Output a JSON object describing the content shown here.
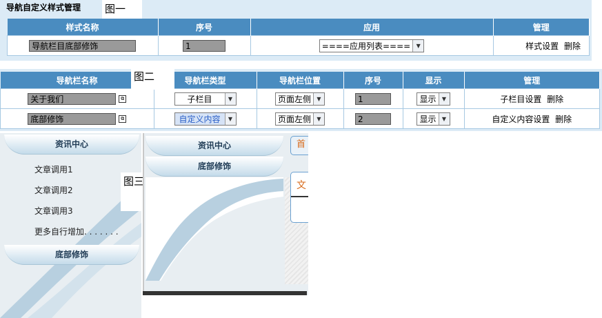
{
  "fig1": {
    "title": "导航自定义样式管理",
    "label": "图一",
    "headers": [
      "样式名称",
      "序号",
      "应用",
      "管理"
    ],
    "row": {
      "name": "导航栏目底部修饰",
      "order": "1",
      "apply": "====应用列表====",
      "action1": "样式设置",
      "action2": "删除"
    }
  },
  "fig2": {
    "label": "图二",
    "headers": [
      "导航栏名称",
      "导航栏类型",
      "导航栏位置",
      "序号",
      "显示",
      "管理"
    ],
    "rows": [
      {
        "name": "关于我们",
        "type": "子栏目",
        "position": "页面左侧",
        "order": "1",
        "display": "显示",
        "action1": "子栏目设置",
        "action2": "删除"
      },
      {
        "name": "底部修饰",
        "type": "自定义内容",
        "position": "页面左侧",
        "order": "2",
        "display": "显示",
        "action1": "自定义内容设置",
        "action2": "删除"
      }
    ]
  },
  "fig3": {
    "label": "图三",
    "left": {
      "head1": "资讯中心",
      "items": [
        "文章调用1",
        "文章调用2",
        "文章调用3",
        "更多自行增加. . . . . . ."
      ],
      "head2": "底部修饰"
    },
    "middle": {
      "head1": "资讯中心",
      "head2": "底部修饰",
      "tab_char": "首",
      "content_char": "文"
    }
  },
  "colors": {
    "header": "#4a8cc0",
    "band": "#dcebf6",
    "accent": "#d86a1a",
    "swoosh": "#b8d0e0"
  }
}
